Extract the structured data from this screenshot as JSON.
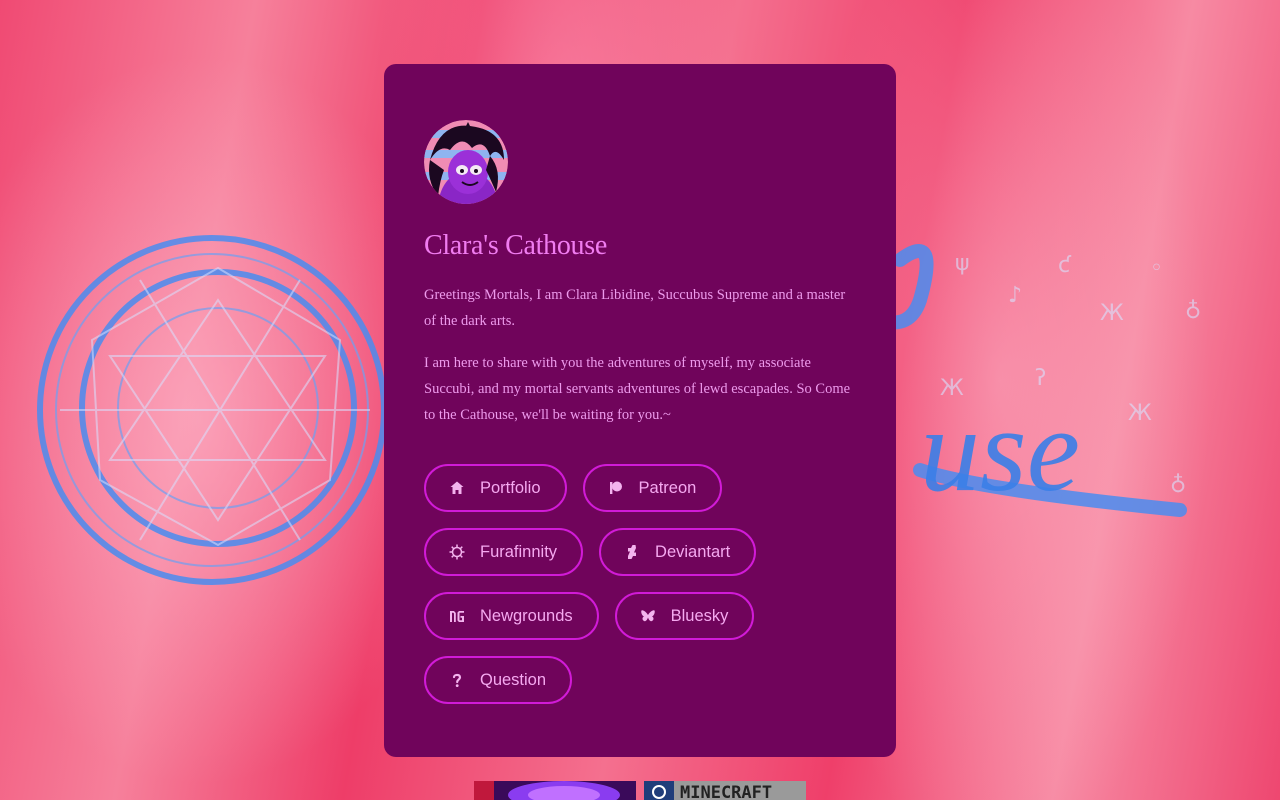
{
  "profile": {
    "name": "Clara's Cathouse",
    "bio": [
      "Greetings Mortals, I am Clara Libidine, Succubus Supreme and a master of the dark arts.",
      "I am here to share with you the adventures of myself, my associate Succubi, and my mortal servants adventures of lewd escapades. So Come to the Cathouse, we'll be waiting for you.~"
    ]
  },
  "links": [
    {
      "label": "Portfolio",
      "icon": "home-icon"
    },
    {
      "label": "Patreon",
      "icon": "patreon-icon"
    },
    {
      "label": "Furafinnity",
      "icon": "furaffinity-icon"
    },
    {
      "label": "Deviantart",
      "icon": "deviantart-icon"
    },
    {
      "label": "Newgrounds",
      "icon": "newgrounds-icon"
    },
    {
      "label": "Bluesky",
      "icon": "bluesky-icon"
    },
    {
      "label": "Question",
      "icon": "question-icon"
    }
  ],
  "badges": [
    {
      "icon": "cathouse-badge"
    },
    {
      "icon": "minecraft-badge",
      "text": "MINECRAFT"
    }
  ],
  "colors": {
    "card": "#70045b",
    "accent": "#f07cf0",
    "button_border": "#d11bd7",
    "background": "#f04a73"
  }
}
